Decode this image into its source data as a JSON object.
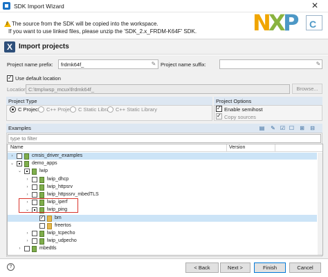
{
  "window": {
    "title": "SDK Import Wizard",
    "close_glyph": "✕"
  },
  "header": {
    "message_line1": "The source from the SDK will be copied into the workspace.",
    "message_line2": "If you want to use linked files, please unzip the 'SDK_2.x_FRDM-K64F' SDK.",
    "logo_letters": [
      "N",
      "X",
      "P"
    ]
  },
  "page": {
    "title": "Import projects",
    "icon_glyph": "X"
  },
  "form": {
    "prefix_label": "Project name prefix:",
    "prefix_value": "frdmk64f_",
    "suffix_label": "Project name suffix:",
    "suffix_value": "",
    "use_default_location_label": "Use default location",
    "use_default_location_checked": true,
    "location_label": "Location:",
    "location_value": "C:\\tmp\\wsp_mcux\\frdmk64f_",
    "browse_label": "Browse..."
  },
  "project_type": {
    "heading": "Project Type",
    "options": [
      {
        "label": "C Project",
        "selected": true
      },
      {
        "label": "C++ Project",
        "selected": false
      },
      {
        "label": "C Static Library",
        "selected": false
      },
      {
        "label": "C++ Static Library",
        "selected": false
      }
    ]
  },
  "project_options": {
    "heading": "Project Options",
    "enable_semihost_label": "Enable semihost",
    "enable_semihost_checked": true,
    "copy_sources_label": "Copy sources",
    "copy_sources_checked": true
  },
  "examples": {
    "heading": "Examples",
    "filter_placeholder": "type to filter",
    "columns": {
      "name": "Name",
      "version": "Version"
    },
    "toolbar_icons": [
      "import-icon",
      "edit-icon",
      "check-all-icon",
      "uncheck-all-icon",
      "expand-all-icon",
      "collapse-all-icon"
    ],
    "rows": [
      {
        "label": "cmsis_driver_examples",
        "level": 0,
        "expanded": false,
        "check": "none",
        "type": "lib",
        "highlighted": true
      },
      {
        "label": "demo_apps",
        "level": 0,
        "expanded": true,
        "check": "partial",
        "type": "lib",
        "highlighted": false
      },
      {
        "label": "lwip",
        "level": 1,
        "expanded": true,
        "check": "partial",
        "type": "lib",
        "highlighted": false
      },
      {
        "label": "lwip_dhcp",
        "level": 2,
        "expanded": false,
        "check": "none",
        "type": "lib",
        "highlighted": false
      },
      {
        "label": "lwip_httpsrv",
        "level": 2,
        "expanded": false,
        "check": "none",
        "type": "lib",
        "highlighted": false
      },
      {
        "label": "lwip_httpssrv_mbedTLS",
        "level": 2,
        "expanded": false,
        "check": "none",
        "type": "lib",
        "highlighted": false
      },
      {
        "label": "lwip_iperf",
        "level": 2,
        "expanded": false,
        "check": "none",
        "type": "lib",
        "highlighted": false
      },
      {
        "label": "lwip_ping",
        "level": 2,
        "expanded": true,
        "check": "partial",
        "type": "lib",
        "highlighted": false
      },
      {
        "label": "bm",
        "level": 3,
        "expanded": null,
        "check": "checked",
        "type": "folder",
        "highlighted": true
      },
      {
        "label": "freertos",
        "level": 3,
        "expanded": null,
        "check": "none",
        "type": "folder",
        "highlighted": false
      },
      {
        "label": "lwip_tcpecho",
        "level": 2,
        "expanded": false,
        "check": "none",
        "type": "lib",
        "highlighted": false
      },
      {
        "label": "lwip_udpecho",
        "level": 2,
        "expanded": false,
        "check": "none",
        "type": "lib",
        "highlighted": false
      },
      {
        "label": "mbedtls",
        "level": 1,
        "expanded": false,
        "check": "none",
        "type": "lib",
        "highlighted": false
      }
    ]
  },
  "footer": {
    "help_glyph": "?",
    "back_label": "< Back",
    "next_label": "Next >",
    "finish_label": "Finish",
    "cancel_label": "Cancel"
  },
  "colors": {
    "highlight": "#cce4f7",
    "annotation": "#d9332b",
    "section": "#dde7f2"
  }
}
